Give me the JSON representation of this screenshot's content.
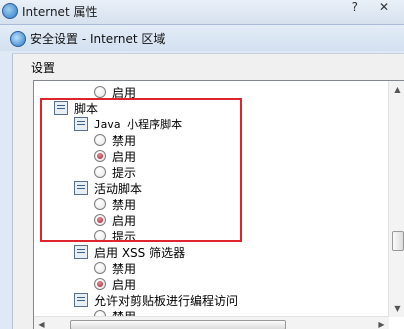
{
  "parent_window": {
    "title": "Internet 属性",
    "help": "?",
    "close": "✕"
  },
  "dialog": {
    "title": "安全设置 - Internet 区域"
  },
  "settings": {
    "label": "设置",
    "tree": {
      "top_enable": "启用",
      "script_category": "脚本",
      "java_applet_script": "Java 小程序脚本",
      "java_disable": "禁用",
      "java_enable": "启用",
      "java_prompt": "提示",
      "active_script": "活动脚本",
      "active_disable": "禁用",
      "active_enable": "启用",
      "active_prompt": "提示",
      "xss_filter": "启用 XSS 筛选器",
      "xss_disable": "禁用",
      "xss_enable": "启用",
      "clipboard_access": "允许对剪贴板进行编程访问",
      "clipboard_disable": "禁用"
    }
  },
  "colors": {
    "highlight_border": "#e0242e",
    "radio_checked": "#b21d31"
  }
}
